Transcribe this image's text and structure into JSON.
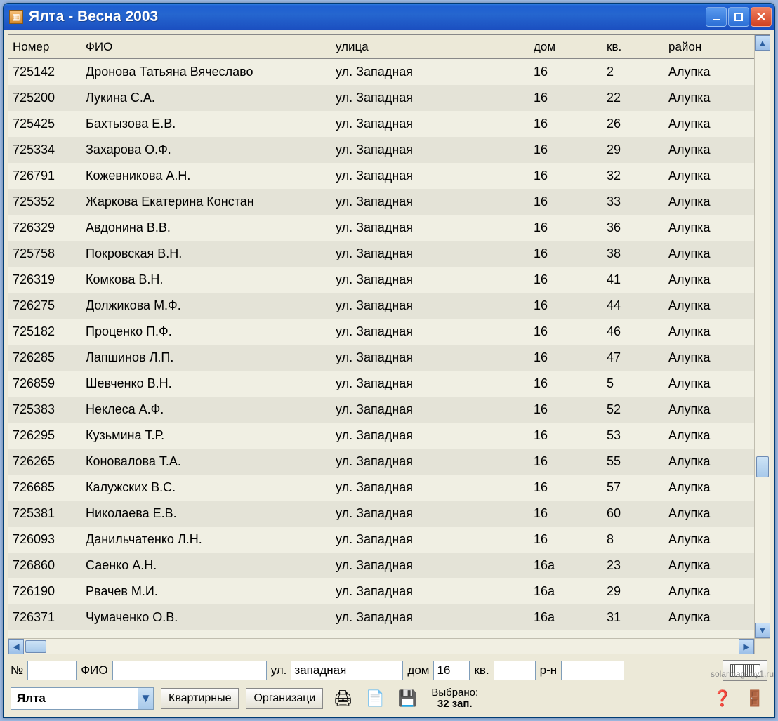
{
  "window": {
    "title": "Ялта  - Весна 2003"
  },
  "columns": {
    "nomer": "Номер",
    "fio": "ФИО",
    "ulica": "улица",
    "dom": "дом",
    "kv": "кв.",
    "rajon": "район"
  },
  "rows": [
    {
      "nomer": "725142",
      "fio": "Дронова Татьяна Вячеславо",
      "ulica": "ул. Западная",
      "dom": "16",
      "kv": "2",
      "rajon": "Алупка"
    },
    {
      "nomer": "725200",
      "fio": "Лукина С.А.",
      "ulica": "ул. Западная",
      "dom": "16",
      "kv": "22",
      "rajon": "Алупка"
    },
    {
      "nomer": "725425",
      "fio": "Бахтызова Е.В.",
      "ulica": "ул. Западная",
      "dom": "16",
      "kv": "26",
      "rajon": "Алупка"
    },
    {
      "nomer": "725334",
      "fio": "Захарова О.Ф.",
      "ulica": "ул. Западная",
      "dom": "16",
      "kv": "29",
      "rajon": "Алупка"
    },
    {
      "nomer": "726791",
      "fio": "Кожевникова А.Н.",
      "ulica": "ул. Западная",
      "dom": "16",
      "kv": "32",
      "rajon": "Алупка"
    },
    {
      "nomer": "725352",
      "fio": "Жаркова Екатерина Констан",
      "ulica": "ул. Западная",
      "dom": "16",
      "kv": "33",
      "rajon": "Алупка"
    },
    {
      "nomer": "726329",
      "fio": "Авдонина В.В.",
      "ulica": "ул. Западная",
      "dom": "16",
      "kv": "36",
      "rajon": "Алупка"
    },
    {
      "nomer": "725758",
      "fio": "Покровская В.Н.",
      "ulica": "ул. Западная",
      "dom": "16",
      "kv": "38",
      "rajon": "Алупка"
    },
    {
      "nomer": "726319",
      "fio": "Комкова В.Н.",
      "ulica": "ул. Западная",
      "dom": "16",
      "kv": "41",
      "rajon": "Алупка"
    },
    {
      "nomer": "726275",
      "fio": "Должикова М.Ф.",
      "ulica": "ул. Западная",
      "dom": "16",
      "kv": "44",
      "rajon": "Алупка"
    },
    {
      "nomer": "725182",
      "fio": "Проценко П.Ф.",
      "ulica": "ул. Западная",
      "dom": "16",
      "kv": "46",
      "rajon": "Алупка"
    },
    {
      "nomer": "726285",
      "fio": "Лапшинов Л.П.",
      "ulica": "ул. Западная",
      "dom": "16",
      "kv": "47",
      "rajon": "Алупка"
    },
    {
      "nomer": "726859",
      "fio": "Шевченко В.Н.",
      "ulica": "ул. Западная",
      "dom": "16",
      "kv": "5",
      "rajon": "Алупка"
    },
    {
      "nomer": "725383",
      "fio": "Неклеса А.Ф.",
      "ulica": "ул. Западная",
      "dom": "16",
      "kv": "52",
      "rajon": "Алупка"
    },
    {
      "nomer": "726295",
      "fio": "Кузьмина Т.Р.",
      "ulica": "ул. Западная",
      "dom": "16",
      "kv": "53",
      "rajon": "Алупка"
    },
    {
      "nomer": "726265",
      "fio": "Коновалова Т.А.",
      "ulica": "ул. Западная",
      "dom": "16",
      "kv": "55",
      "rajon": "Алупка"
    },
    {
      "nomer": "726685",
      "fio": "Калужских В.С.",
      "ulica": "ул. Западная",
      "dom": "16",
      "kv": "57",
      "rajon": "Алупка"
    },
    {
      "nomer": "725381",
      "fio": "Николаева Е.В.",
      "ulica": "ул. Западная",
      "dom": "16",
      "kv": "60",
      "rajon": "Алупка"
    },
    {
      "nomer": "726093",
      "fio": "Данильчатенко Л.Н.",
      "ulica": "ул. Западная",
      "dom": "16",
      "kv": "8",
      "rajon": "Алупка"
    },
    {
      "nomer": "726860",
      "fio": "Саенко А.Н.",
      "ulica": "ул. Западная",
      "dom": "16а",
      "kv": "23",
      "rajon": "Алупка"
    },
    {
      "nomer": "726190",
      "fio": "Рвачев М.И.",
      "ulica": "ул. Западная",
      "dom": "16а",
      "kv": "29",
      "rajon": "Алупка"
    },
    {
      "nomer": "726371",
      "fio": "Чумаченко О.В.",
      "ulica": "ул. Западная",
      "dom": "16а",
      "kv": "31",
      "rajon": "Алупка"
    }
  ],
  "filter": {
    "label_no": "№",
    "label_fio": "ФИО",
    "label_ul": "ул.",
    "label_dom": "дом",
    "label_kv": "кв.",
    "label_rn": "р-н",
    "value_no": "",
    "value_fio": "",
    "value_ul": "западная",
    "value_dom": "16",
    "value_kv": "",
    "value_rn": ""
  },
  "toolbar": {
    "city": "Ялта",
    "btn_kvartirnye": "Квартирные",
    "btn_organizacii": "Организаци",
    "status_label": "Выбрано:",
    "status_count": "32 зап."
  },
  "watermark": "solarmag-my1.ru"
}
